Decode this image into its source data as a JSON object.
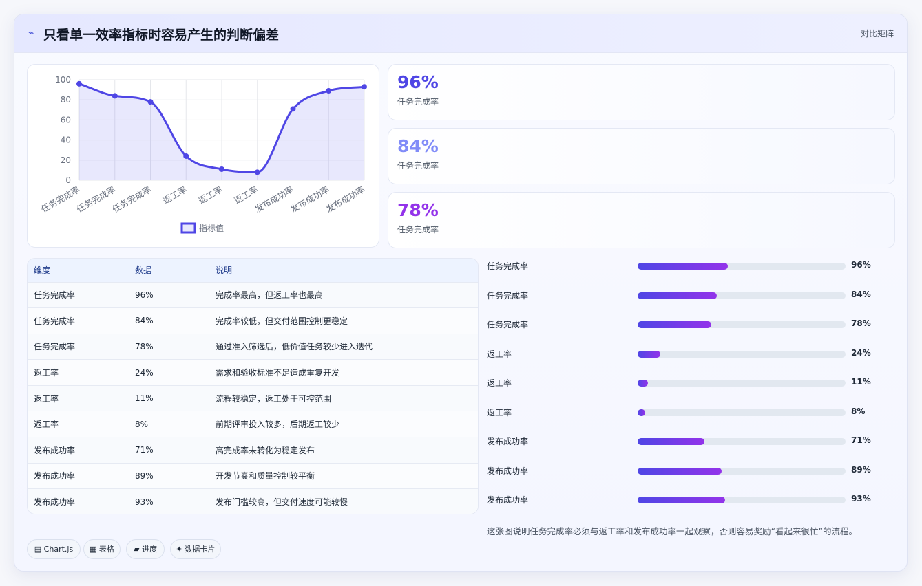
{
  "header": {
    "title": "只看单一效率指标时容易产生的判断偏差",
    "tag": "对比矩阵",
    "icon": "spark-icon"
  },
  "chart_data": {
    "type": "line",
    "categories": [
      "任务完成率",
      "任务完成率",
      "任务完成率",
      "返工率",
      "返工率",
      "返工率",
      "发布成功率",
      "发布成功率",
      "发布成功率"
    ],
    "series": [
      {
        "name": "指标值",
        "values": [
          96,
          84,
          78,
          24,
          11,
          8,
          71,
          89,
          93
        ]
      }
    ],
    "ylim": [
      0,
      100
    ],
    "yticks": [
      "0",
      "20",
      "40",
      "60",
      "80",
      "100"
    ],
    "legend": "bottom",
    "grid": true,
    "area_fill": true,
    "line_color": "#4f46e5"
  },
  "stats": [
    {
      "value": "96%",
      "label": "任务完成率",
      "color": "#4f46e5"
    },
    {
      "value": "84%",
      "label": "任务完成率",
      "color": "#818cf8"
    },
    {
      "value": "78%",
      "label": "任务完成率",
      "color": "#9333ea"
    }
  ],
  "table": {
    "headers": [
      "维度",
      "数据",
      "说明"
    ],
    "rows": [
      [
        "任务完成率",
        "96%",
        "完成率最高，但返工率也最高"
      ],
      [
        "任务完成率",
        "84%",
        "完成率较低，但交付范围控制更稳定"
      ],
      [
        "任务完成率",
        "78%",
        "通过准入筛选后，低价值任务较少进入迭代"
      ],
      [
        "返工率",
        "24%",
        "需求和验收标准不足造成重复开发"
      ],
      [
        "返工率",
        "11%",
        "流程较稳定，返工处于可控范围"
      ],
      [
        "返工率",
        "8%",
        "前期评审投入较多，后期返工较少"
      ],
      [
        "发布成功率",
        "71%",
        "高完成率未转化为稳定发布"
      ],
      [
        "发布成功率",
        "89%",
        "开发节奏和质量控制较平衡"
      ],
      [
        "发布成功率",
        "93%",
        "发布门槛较高，但交付速度可能较慢"
      ]
    ]
  },
  "progress": [
    {
      "label": "任务完成率",
      "pct": "96%",
      "fill": 0.435
    },
    {
      "label": "任务完成率",
      "pct": "84%",
      "fill": 0.38
    },
    {
      "label": "任务完成率",
      "pct": "78%",
      "fill": 0.355
    },
    {
      "label": "返工率",
      "pct": "24%",
      "fill": 0.11
    },
    {
      "label": "返工率",
      "pct": "11%",
      "fill": 0.05
    },
    {
      "label": "返工率",
      "pct": "8%",
      "fill": 0.036
    },
    {
      "label": "发布成功率",
      "pct": "71%",
      "fill": 0.32
    },
    {
      "label": "发布成功率",
      "pct": "89%",
      "fill": 0.405
    },
    {
      "label": "发布成功率",
      "pct": "93%",
      "fill": 0.42
    }
  ],
  "note": "这张图说明任务完成率必须与返工率和发布成功率一起观察，否则容易奖励“看起来很忙”的流程。",
  "chips": [
    {
      "label": "▤ Chart.js"
    },
    {
      "label": "▦ 表格"
    },
    {
      "label": "▰ 进度"
    },
    {
      "label": "✦ 数据卡片"
    }
  ]
}
